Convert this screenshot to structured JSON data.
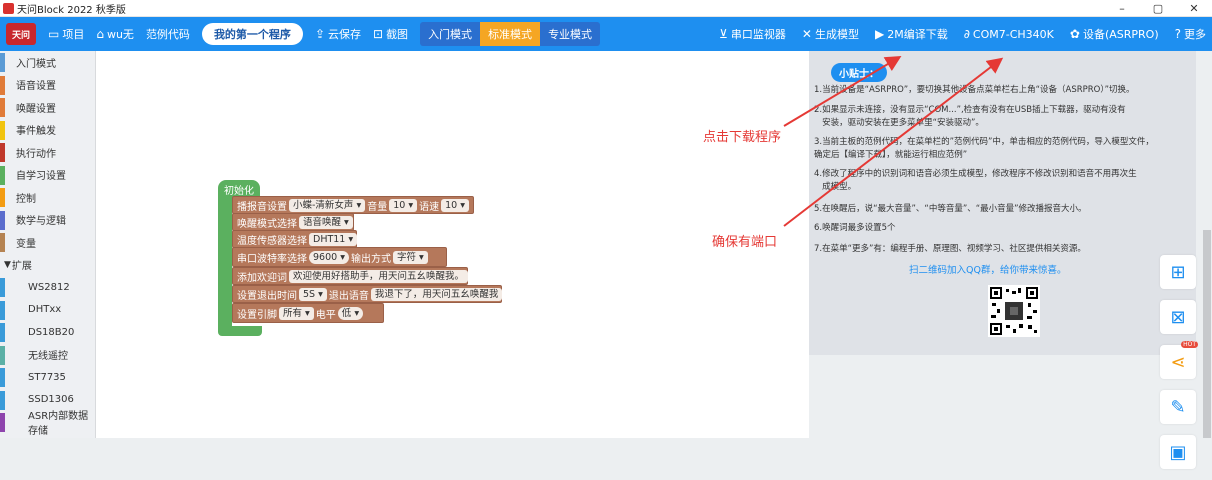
{
  "window": {
    "title": "天问Block 2022 秋季版",
    "controls": [
      "–",
      "▢",
      "✕"
    ]
  },
  "toolbar": {
    "logo": "天问",
    "project": "项目",
    "wuyu": "wu无",
    "examples": "范例代码",
    "program_name": "我的第一个程序",
    "cloud_save": "云保存",
    "screenshot": "截图",
    "modes": [
      "入门模式",
      "标准模式",
      "专业模式"
    ],
    "active_mode": "标准模式",
    "serial_monitor": "串口监视器",
    "gen_model": "生成模型",
    "compile_download": "2M编译下载",
    "port": "COM7-CH340K",
    "device": "设备(ASRPRO)",
    "more": "更多"
  },
  "sidebar": {
    "items": [
      {
        "label": "入门模式",
        "color": "#5b9bd5"
      },
      {
        "label": "语音设置",
        "color": "#e07b39"
      },
      {
        "label": "唤醒设置",
        "color": "#e07b39"
      },
      {
        "label": "事件触发",
        "color": "#f1c40f"
      },
      {
        "label": "执行动作",
        "color": "#c0392b"
      },
      {
        "label": "自学习设置",
        "color": "#5bb05f"
      },
      {
        "label": "控制",
        "color": "#f39c12"
      },
      {
        "label": "数学与逻辑",
        "color": "#5b6dcd"
      },
      {
        "label": "变量",
        "color": "#b58352"
      },
      {
        "label": "扩展",
        "color": "",
        "expand": true
      },
      {
        "label": "WS2812",
        "color": "#3a9bd9",
        "sub": true
      },
      {
        "label": "DHTxx",
        "color": "#3a9bd9",
        "sub": true
      },
      {
        "label": "DS18B20",
        "color": "#3a9bd9",
        "sub": true
      },
      {
        "label": "无线遥控",
        "color": "#5bb0a6",
        "sub": true
      },
      {
        "label": "ST7735",
        "color": "#3a9bd9",
        "sub": true
      },
      {
        "label": "SSD1306",
        "color": "#3a9bd9",
        "sub": true
      },
      {
        "label": "ASR内部数据存储",
        "color": "#8e44ad",
        "sub": true
      }
    ]
  },
  "blocks": {
    "init": "初始化",
    "b1_label": "播报音设置",
    "b1_voice": "小蝶-清新女声 ▾",
    "b1_vol_label": "音量",
    "b1_vol": "10 ▾",
    "b1_speed_label": "语速",
    "b1_speed": "10 ▾",
    "b2_label": "唤醒模式选择",
    "b2_value": "语音唤醒 ▾",
    "b3_label": "温度传感器选择",
    "b3_value": "DHT11 ▾",
    "b4_label": "串口波特率选择",
    "b4_value": "9600 ▾",
    "b4_out_label": "输出方式",
    "b4_out": "字符 ▾",
    "b5_label": "添加欢迎词",
    "b5_value": "欢迎使用好搭助手，用天问五幺唤醒我。",
    "b6_label": "设置退出时间",
    "b6_time": "5S ▾",
    "b6_exit_label": "退出语音",
    "b6_exit": "我退下了，用天问五幺唤醒我",
    "b7_label": "设置引脚",
    "b7_pin": "所有 ▾",
    "b7_level_label": "电平",
    "b7_level": "低 ▾"
  },
  "tips": {
    "title": "小贴士：",
    "lines": [
      "1.当前设备是“ASRPRO”，要切换其他设备点菜单栏右上角“设备（ASRPRO）”切换。",
      "2.如果显示未连接，没有显示“COM...”,检查有没有在USB插上下载器，驱动有没有\n   安装，驱动安装在更多菜单里“安装驱动”。",
      "3.当前主板的范例代码，在菜单栏的”范例代码”中，单击相应的范例代码，导入模型文件，\n确定后【编译下载】，就能运行相应范例”",
      "4.修改了程序中的识别词和语音必须生成模型，修改程序不修改识别和语音不用再次生\n   成模型。",
      "5.在唤醒后，说“最大音量”、“中等音量”、“最小音量”修改播报音大小。",
      "6.唤醒词最多设置5个",
      "7.在菜单“更多”有：编程手册、原理图、视频学习、社区提供相关资源。"
    ],
    "qq": "扫二维码加入QQ群，给你带来惊喜。"
  },
  "annotations": {
    "click_download": "点击下载程序",
    "ensure_port": "确保有端口"
  },
  "float": {
    "hot": "HOT"
  }
}
